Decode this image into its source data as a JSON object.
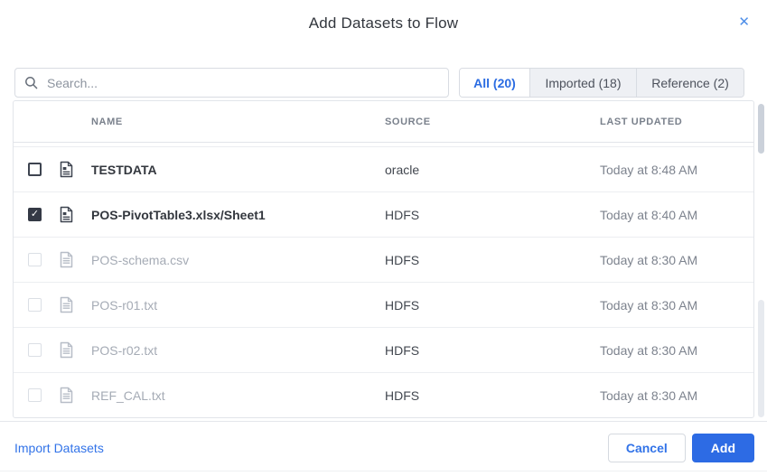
{
  "modal": {
    "title": "Add Datasets to Flow"
  },
  "icons": {
    "close": "✕",
    "check": "✓",
    "search": "magnifier"
  },
  "colors": {
    "accent_blue": "#2b6ce2",
    "button_blue": "#2d6be4",
    "checkbox_dark": "#343945",
    "disabled_text": "#a5abb5"
  },
  "search": {
    "placeholder": "Search...",
    "value": ""
  },
  "tabs": [
    {
      "label": "All (20)",
      "active": true
    },
    {
      "label": "Imported (18)",
      "active": false
    },
    {
      "label": "Reference (2)",
      "active": false
    }
  ],
  "table": {
    "columns": [
      "NAME",
      "SOURCE",
      "LAST UPDATED"
    ],
    "rows": [
      {
        "name": "TESTDATA",
        "source": "oracle",
        "updated": "Today at 8:48 AM",
        "checked": false,
        "enabled": true
      },
      {
        "name": "POS-PivotTable3.xlsx/Sheet1",
        "source": "HDFS",
        "updated": "Today at 8:40 AM",
        "checked": true,
        "enabled": true
      },
      {
        "name": "POS-schema.csv",
        "source": "HDFS",
        "updated": "Today at 8:30 AM",
        "checked": false,
        "enabled": false
      },
      {
        "name": "POS-r01.txt",
        "source": "HDFS",
        "updated": "Today at 8:30 AM",
        "checked": false,
        "enabled": false
      },
      {
        "name": "POS-r02.txt",
        "source": "HDFS",
        "updated": "Today at 8:30 AM",
        "checked": false,
        "enabled": false
      },
      {
        "name": "REF_CAL.txt",
        "source": "HDFS",
        "updated": "Today at 8:30 AM",
        "checked": false,
        "enabled": false
      }
    ]
  },
  "footer": {
    "import_link": "Import Datasets",
    "cancel_label": "Cancel",
    "add_label": "Add"
  }
}
